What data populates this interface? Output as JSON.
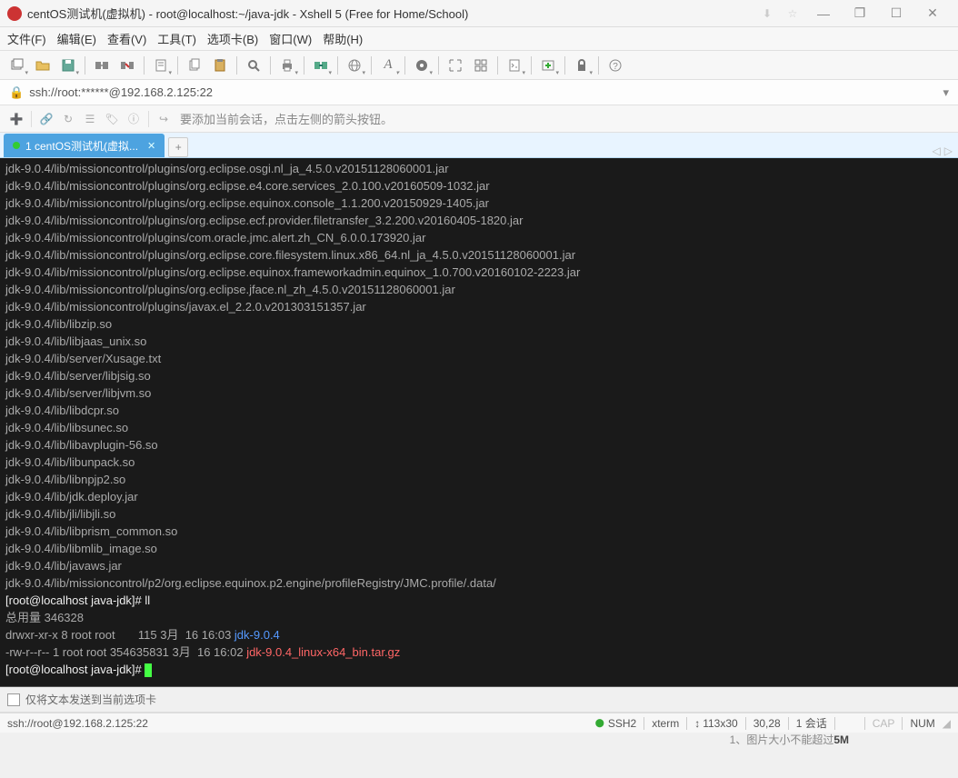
{
  "window": {
    "title": "centOS测试机(虚拟机) - root@localhost:~/java-jdk - Xshell 5 (Free for Home/School)"
  },
  "menu": {
    "file": "文件(F)",
    "edit": "编辑(E)",
    "view": "查看(V)",
    "tools": "工具(T)",
    "tabs": "选项卡(B)",
    "window": "窗口(W)",
    "help": "帮助(H)"
  },
  "address": {
    "url": "ssh://root:******@192.168.2.125:22"
  },
  "session_hint": "要添加当前会话，点击左侧的箭头按钮。",
  "tab": {
    "label": "1 centOS测试机(虚拟...",
    "add": "+"
  },
  "terminal_lines": [
    {
      "t": "jdk-9.0.4/lib/missioncontrol/plugins/org.eclipse.osgi.nl_ja_4.5.0.v20151128060001.jar"
    },
    {
      "t": "jdk-9.0.4/lib/missioncontrol/plugins/org.eclipse.e4.core.services_2.0.100.v20160509-1032.jar"
    },
    {
      "t": "jdk-9.0.4/lib/missioncontrol/plugins/org.eclipse.equinox.console_1.1.200.v20150929-1405.jar"
    },
    {
      "t": "jdk-9.0.4/lib/missioncontrol/plugins/org.eclipse.ecf.provider.filetransfer_3.2.200.v20160405-1820.jar"
    },
    {
      "t": "jdk-9.0.4/lib/missioncontrol/plugins/com.oracle.jmc.alert.zh_CN_6.0.0.173920.jar"
    },
    {
      "t": "jdk-9.0.4/lib/missioncontrol/plugins/org.eclipse.core.filesystem.linux.x86_64.nl_ja_4.5.0.v20151128060001.jar"
    },
    {
      "t": "jdk-9.0.4/lib/missioncontrol/plugins/org.eclipse.equinox.frameworkadmin.equinox_1.0.700.v20160102-2223.jar"
    },
    {
      "t": "jdk-9.0.4/lib/missioncontrol/plugins/org.eclipse.jface.nl_zh_4.5.0.v20151128060001.jar"
    },
    {
      "t": "jdk-9.0.4/lib/missioncontrol/plugins/javax.el_2.2.0.v201303151357.jar"
    },
    {
      "t": "jdk-9.0.4/lib/libzip.so"
    },
    {
      "t": "jdk-9.0.4/lib/libjaas_unix.so"
    },
    {
      "t": "jdk-9.0.4/lib/server/Xusage.txt"
    },
    {
      "t": "jdk-9.0.4/lib/server/libjsig.so"
    },
    {
      "t": "jdk-9.0.4/lib/server/libjvm.so"
    },
    {
      "t": "jdk-9.0.4/lib/libdcpr.so"
    },
    {
      "t": "jdk-9.0.4/lib/libsunec.so"
    },
    {
      "t": "jdk-9.0.4/lib/libavplugin-56.so"
    },
    {
      "t": "jdk-9.0.4/lib/libunpack.so"
    },
    {
      "t": "jdk-9.0.4/lib/libnpjp2.so"
    },
    {
      "t": "jdk-9.0.4/lib/jdk.deploy.jar"
    },
    {
      "t": "jdk-9.0.4/lib/jli/libjli.so"
    },
    {
      "t": "jdk-9.0.4/lib/libprism_common.so"
    },
    {
      "t": "jdk-9.0.4/lib/libmlib_image.so"
    },
    {
      "t": "jdk-9.0.4/lib/javaws.jar"
    },
    {
      "t": "jdk-9.0.4/lib/missioncontrol/p2/org.eclipse.equinox.p2.engine/profileRegistry/JMC.profile/.data/"
    },
    {
      "t": "[root@localhost java-jdk]# ll",
      "c": "prompt"
    },
    {
      "t": "总用量 346328"
    },
    {
      "t": "drwxr-xr-x 8 root root       115 3月  16 16:03 ",
      "append": "jdk-9.0.4",
      "ac": "blue"
    },
    {
      "t": "-rw-r--r-- 1 root root 354635831 3月  16 16:02 ",
      "append": "jdk-9.0.4_linux-x64_bin.tar.gz",
      "ac": "red"
    },
    {
      "t": "[root@localhost java-jdk]# ",
      "c": "prompt",
      "cursor": true
    }
  ],
  "bottombar": {
    "label": "仅将文本发送到当前选项卡"
  },
  "overlay": {
    "text": "1、图片大小不能超过",
    "bold": "5M"
  },
  "status": {
    "conn": "ssh://root@192.168.2.125:22",
    "ssh": "SSH2",
    "term": "xterm",
    "size": "113x30",
    "pos": "30,28",
    "sess": "1 会话",
    "cap": "CAP",
    "num": "NUM"
  },
  "icons": {
    "ssh_indicator": "⬤",
    "size_arrows": "↕",
    "tab_prev": "◁",
    "tab_next": "▷"
  }
}
